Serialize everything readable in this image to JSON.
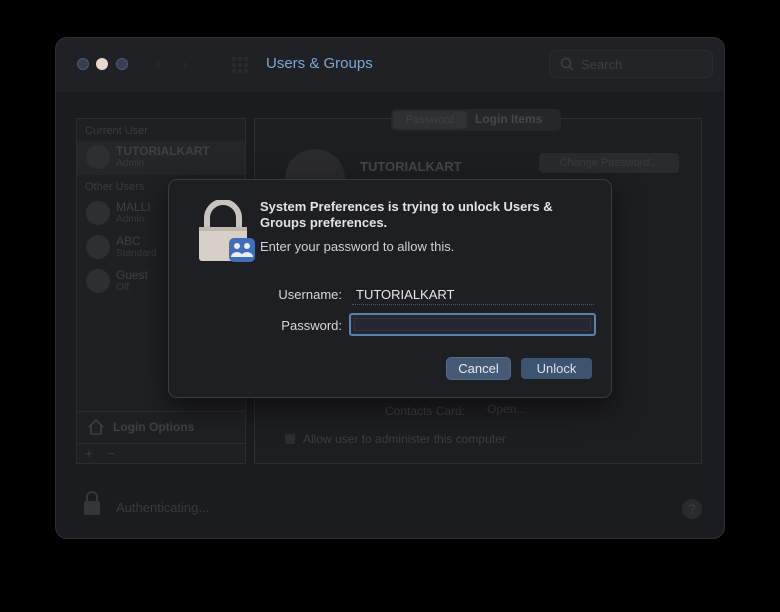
{
  "window": {
    "title": "Users & Groups",
    "search_placeholder": "Search"
  },
  "sidebar": {
    "current_user_label": "Current User",
    "other_users_label": "Other Users",
    "current_user": {
      "name": "TUTORIALKART",
      "role": "Admin"
    },
    "other_users": [
      {
        "name": "MALLI",
        "role": "Admin"
      },
      {
        "name": "ABC",
        "role": "Standard"
      },
      {
        "name": "Guest",
        "role": "Off"
      }
    ],
    "login_options_label": "Login Options",
    "add_label": "+",
    "remove_label": "−"
  },
  "panel": {
    "tabs": [
      "Password",
      "Login Items"
    ],
    "user_name": "TUTORIALKART",
    "change_password_label": "Change Password...",
    "contacts_card_label": "Contacts Card:",
    "open_label": "Open...",
    "admin_checkbox_label": "Allow user to administer this computer"
  },
  "footer": {
    "status_text": "Authenticating...",
    "help_label": "?"
  },
  "dialog": {
    "title": "System Preferences is trying to unlock Users & Groups preferences.",
    "subtitle": "Enter your password to allow this.",
    "username_label": "Username:",
    "username_value": "TUTORIALKART",
    "password_label": "Password:",
    "password_value": "",
    "cancel_label": "Cancel",
    "unlock_label": "Unlock"
  },
  "colors": {
    "accent": "#5a7fb0",
    "title_blue": "#7aa6d9",
    "button": "#455a75"
  }
}
